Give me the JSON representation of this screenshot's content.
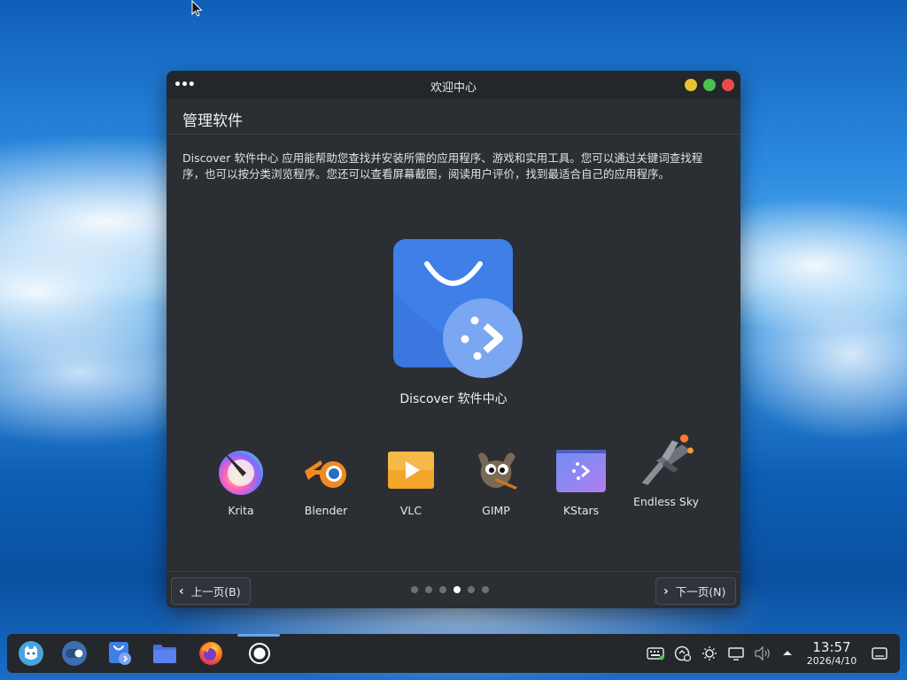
{
  "window": {
    "title": "欢迎中心",
    "menu_glyph": "•••"
  },
  "page": {
    "title": "管理软件",
    "description": "Discover 软件中心 应用能帮助您查找并安装所需的应用程序、游戏和实用工具。您可以通过关键词查找程序，也可以按分类浏览程序。您还可以查看屏幕截图，阅读用户评价，找到最适合自己的应用程序。",
    "hero_label": "Discover 软件中心"
  },
  "apps": [
    {
      "name": "Krita",
      "icon": "krita-icon"
    },
    {
      "name": "Blender",
      "icon": "blender-icon"
    },
    {
      "name": "VLC",
      "icon": "vlc-icon"
    },
    {
      "name": "GIMP",
      "icon": "gimp-icon"
    },
    {
      "name": "KStars",
      "icon": "kstars-icon"
    },
    {
      "name": "Endless Sky",
      "icon": "endless-sky-icon"
    }
  ],
  "nav": {
    "prev_label": "上一页(B)",
    "next_label": "下一页(N)",
    "page_count": 6,
    "active_page": 4
  },
  "taskbar": {
    "apps": [
      "application-launcher-icon",
      "system-settings-icon",
      "discover-icon",
      "file-manager-icon",
      "firefox-icon",
      "screen-recorder-icon"
    ],
    "clock": {
      "time": "13:57",
      "date": "2026/4/10"
    }
  },
  "colors": {
    "accent": "#4f8df5",
    "window_bg": "#2b2e33",
    "close": "#e94b4b",
    "maximize": "#4cc14e",
    "minimize": "#e6c430"
  }
}
